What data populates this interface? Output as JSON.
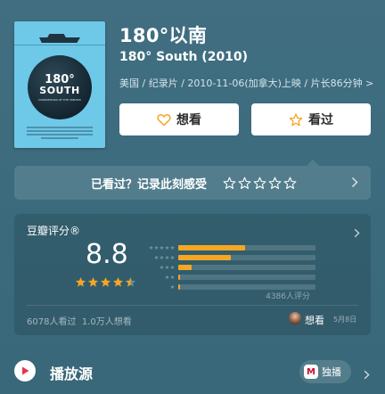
{
  "movie": {
    "title": "180°以南",
    "subtitle": "180° South (2010)",
    "meta": "美国 / 纪录片 / 2010-11-06(加拿大)上映 / 片长86分钟 >",
    "poster": {
      "line1": "180°",
      "line2": "SOUTH",
      "tagline": "CONQUERORS OF THE USELESS"
    }
  },
  "actions": {
    "want_label": "想看",
    "seen_label": "看过"
  },
  "rate_prompt": {
    "text": "已看过？记录此刻感受",
    "stars": 5
  },
  "score": {
    "label": "豆瓣评分®",
    "value": "8.8",
    "stars": 4.5,
    "distribution": [
      {
        "stars": 5,
        "fraction": 0.49
      },
      {
        "stars": 4,
        "fraction": 0.38
      },
      {
        "stars": 3,
        "fraction": 0.1
      },
      {
        "stars": 2,
        "fraction": 0.01
      },
      {
        "stars": 1,
        "fraction": 0.01
      }
    ],
    "rating_count": "4386人评分",
    "seen_count": "6078人看过",
    "want_count": "1.0万人想看",
    "friend_action": "想看",
    "friend_date": "5月8日"
  },
  "play": {
    "title": "播放源",
    "source_label": "独播",
    "source_logo": "M"
  },
  "colors": {
    "background": "#3d6f82",
    "star": "#f5a623",
    "play_icon": "#e8344e"
  }
}
